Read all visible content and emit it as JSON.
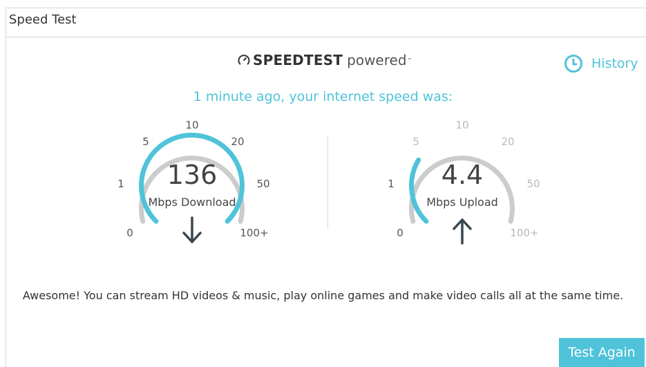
{
  "panel": {
    "title": "Speed Test"
  },
  "brand": {
    "name": "SPEEDTEST",
    "suffix": "powered",
    "tm": "™"
  },
  "history": {
    "label": "History",
    "icon": "clock-icon"
  },
  "subtitle": "1 minute ago, your internet speed was:",
  "gauge_ticks": [
    "0",
    "1",
    "5",
    "10",
    "20",
    "50",
    "100+"
  ],
  "download": {
    "value": "136",
    "unit": "Mbps Download",
    "fill_fraction": 1.0,
    "icon": "arrow-down-icon"
  },
  "upload": {
    "value": "4.4",
    "unit": "Mbps Upload",
    "fill_fraction": 0.28,
    "icon": "arrow-up-icon"
  },
  "message": "Awesome! You can stream HD videos & music, play online games and make video calls all at the same time.",
  "buttons": {
    "test_again": "Test Again"
  },
  "colors": {
    "accent": "#4fc3d9",
    "track": "#cccccc",
    "text": "#333333",
    "arrow": "#37474f"
  }
}
